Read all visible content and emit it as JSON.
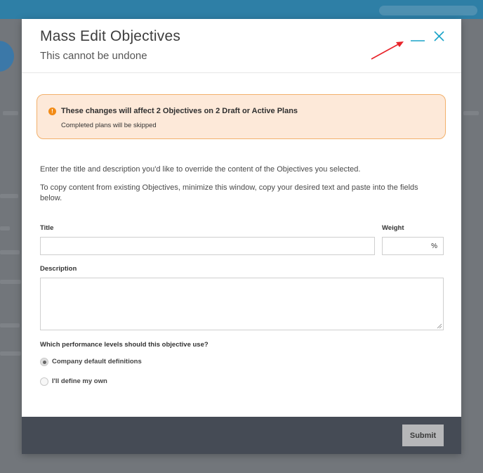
{
  "modal": {
    "title": "Mass Edit Objectives",
    "subtitle": "This cannot be undone"
  },
  "alert": {
    "icon": "!",
    "title": "These changes will affect 2 Objectives on 2 Draft or Active Plans",
    "text": "Completed plans will be skipped"
  },
  "instructions": [
    "Enter the title and description you'd like to override the content of the Objectives you selected.",
    "To copy content from existing Objectives, minimize this window, copy your desired text and paste into the fields below."
  ],
  "form": {
    "title_label": "Title",
    "title_value": "",
    "weight_label": "Weight",
    "weight_value": "",
    "weight_unit": "%",
    "description_label": "Description",
    "description_value": "",
    "performance_question": "Which performance levels should this objective use?",
    "options": [
      {
        "label": "Company default definitions",
        "selected": true
      },
      {
        "label": "I'll define my own",
        "selected": false
      }
    ]
  },
  "footer": {
    "submit_label": "Submit"
  },
  "colors": {
    "accent": "#1aa3c9",
    "alert_border": "#f2b06b",
    "alert_bg": "#fde9d9",
    "footer_bg": "#454b55",
    "annotation_arrow": "#e8232a"
  },
  "icons": {
    "minimize": "minimize-icon",
    "close": "close-icon",
    "alert": "warning-icon"
  }
}
